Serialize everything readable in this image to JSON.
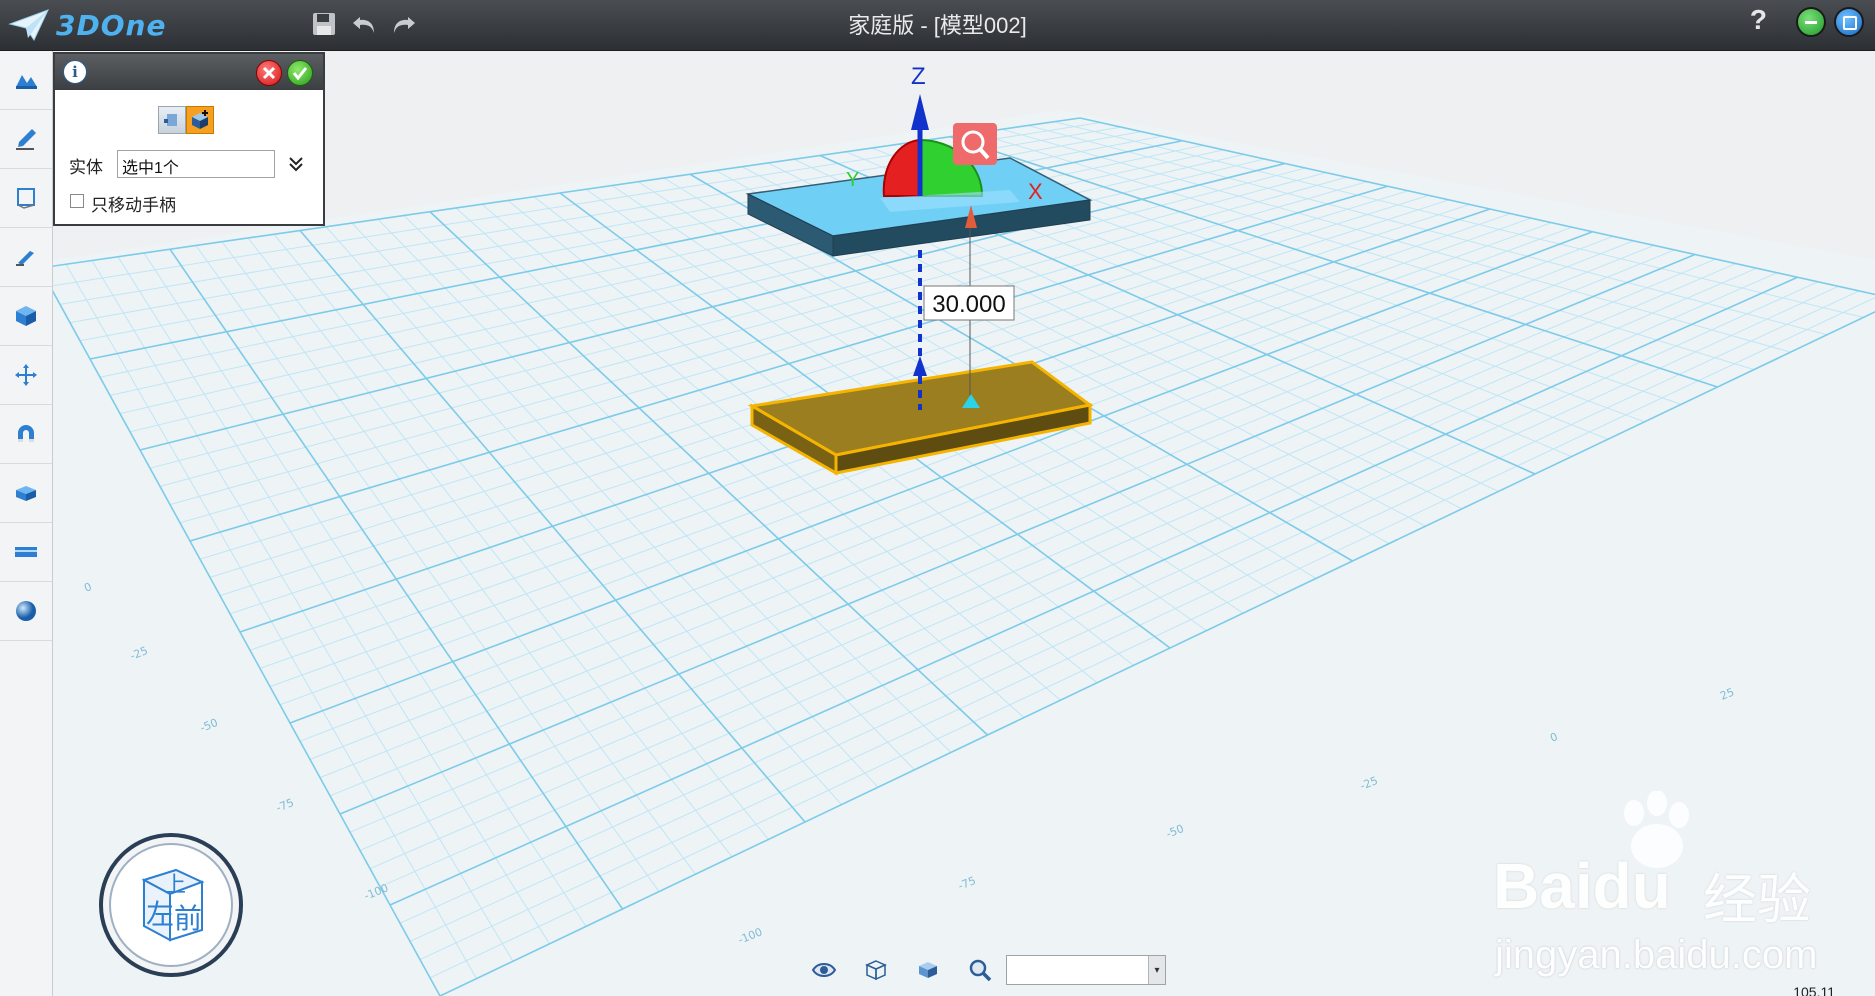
{
  "app": {
    "logo": "3DOne",
    "title": "家庭版 - [模型002]",
    "help": "?"
  },
  "panel": {
    "entity_label": "实体",
    "entity_value": "选中1个",
    "move_handle_label": "只移动手柄",
    "move_handle_checked": false
  },
  "viewport": {
    "axis_z": "Z",
    "axis_x": "X",
    "axis_y": "Y",
    "distance": "30.000",
    "grid_labels": [
      "0",
      "-25",
      "-50",
      "-75",
      "-100",
      "25",
      "0",
      "-25",
      "-50",
      "-75",
      "-100"
    ]
  },
  "viewcube": {
    "top": "上",
    "left": "左",
    "front": "前"
  },
  "bottom": {
    "combo_value": ""
  },
  "watermark": {
    "brand": "Baidu",
    "sub": "经验",
    "url": "jingyan.baidu.com"
  },
  "corner": "105.11",
  "icons": {
    "toolbar": [
      "save-icon",
      "undo-icon",
      "redo-icon"
    ],
    "leftbar": [
      "basic-shape-icon",
      "sketch-icon",
      "sketch-edit-icon",
      "feature-icon",
      "solid-edit-icon",
      "move-icon",
      "combine-icon",
      "pattern-icon",
      "measure-icon",
      "material-icon"
    ]
  },
  "colors": {
    "accent": "#4fb2f0",
    "selected": "#f5b400",
    "grid": "#8fd3ef",
    "box_top": "#6fcff5"
  }
}
